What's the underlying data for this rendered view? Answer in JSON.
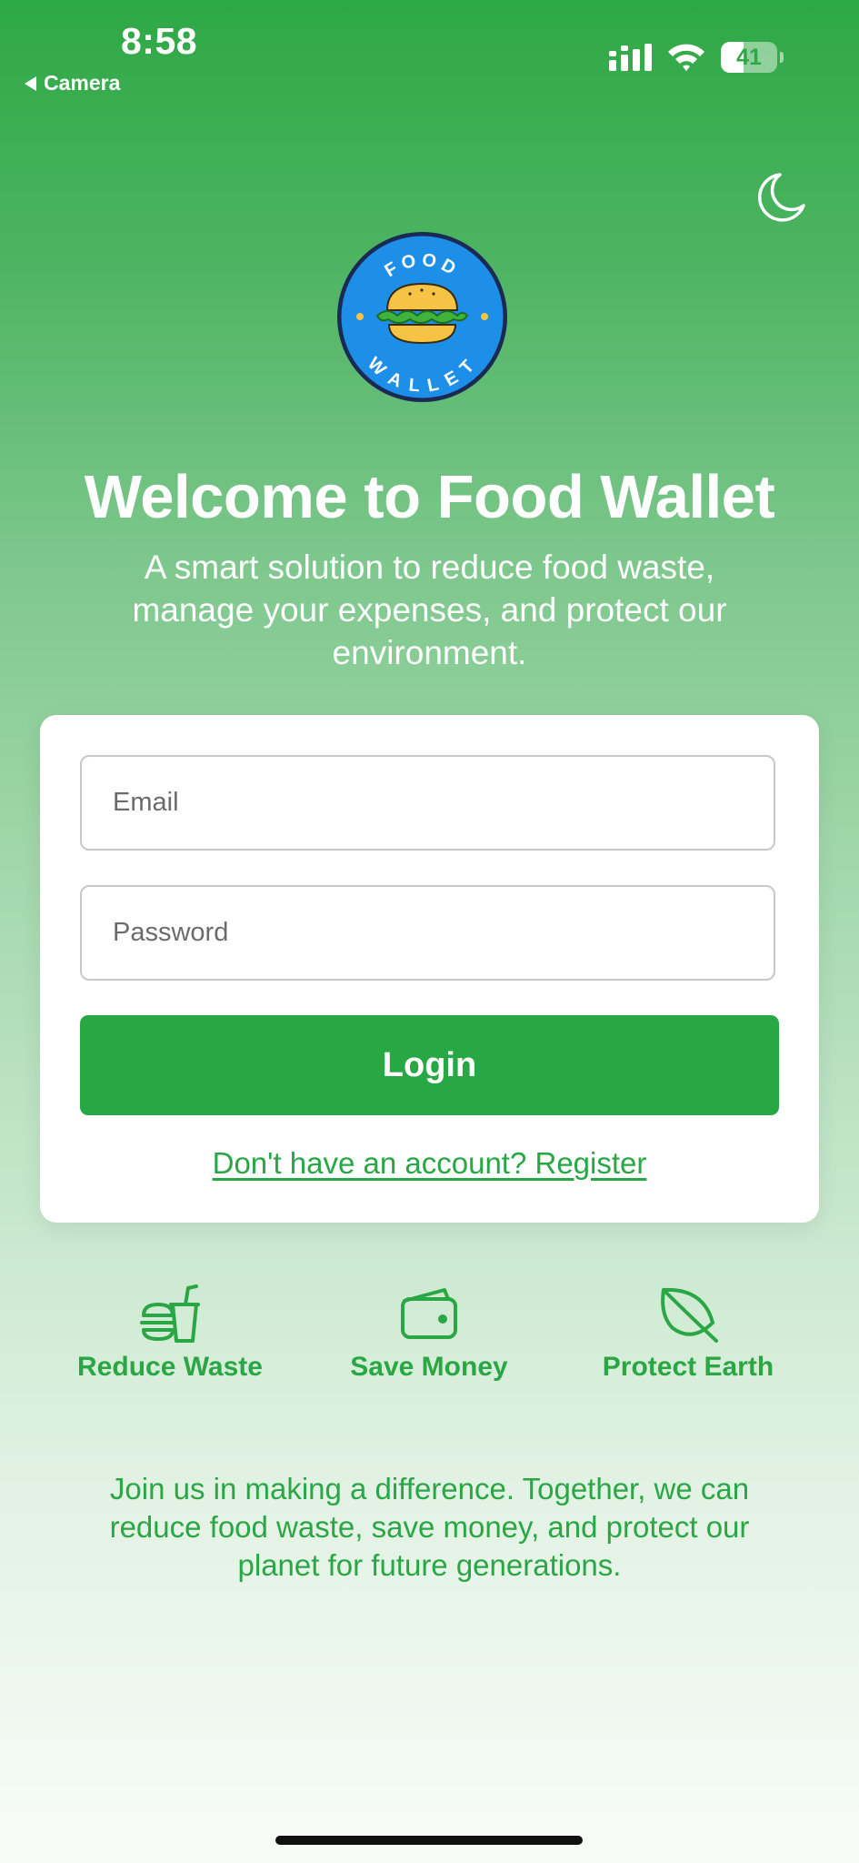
{
  "status_bar": {
    "time": "8:58",
    "back_label": "Camera",
    "battery_level": "41",
    "battery_fraction": 0.41
  },
  "theme_toggle": {
    "icon": "moon-icon"
  },
  "logo": {
    "top_text": "FOOD",
    "bottom_text": "WALLET"
  },
  "header": {
    "title": "Welcome to Food Wallet",
    "subtitle_lines": [
      "A smart solution to reduce food waste,",
      "manage your expenses, and protect our",
      "environment."
    ]
  },
  "login": {
    "email_placeholder": "Email",
    "password_placeholder": "Password",
    "login_label": "Login",
    "register_link": "Don't have an account? Register"
  },
  "features": [
    {
      "icon": "fast-food-icon",
      "label": "Reduce Waste"
    },
    {
      "icon": "wallet-icon",
      "label": "Save Money"
    },
    {
      "icon": "leaf-icon",
      "label": "Protect Earth"
    }
  ],
  "footer": {
    "lines": [
      "Join us in making a difference. Together, we can",
      "reduce food waste, save money, and protect our",
      "planet for future generations."
    ]
  },
  "colors": {
    "brand_green": "#28a745",
    "logo_blue": "#1e8fe8",
    "logo_yellow": "#f6c445"
  }
}
